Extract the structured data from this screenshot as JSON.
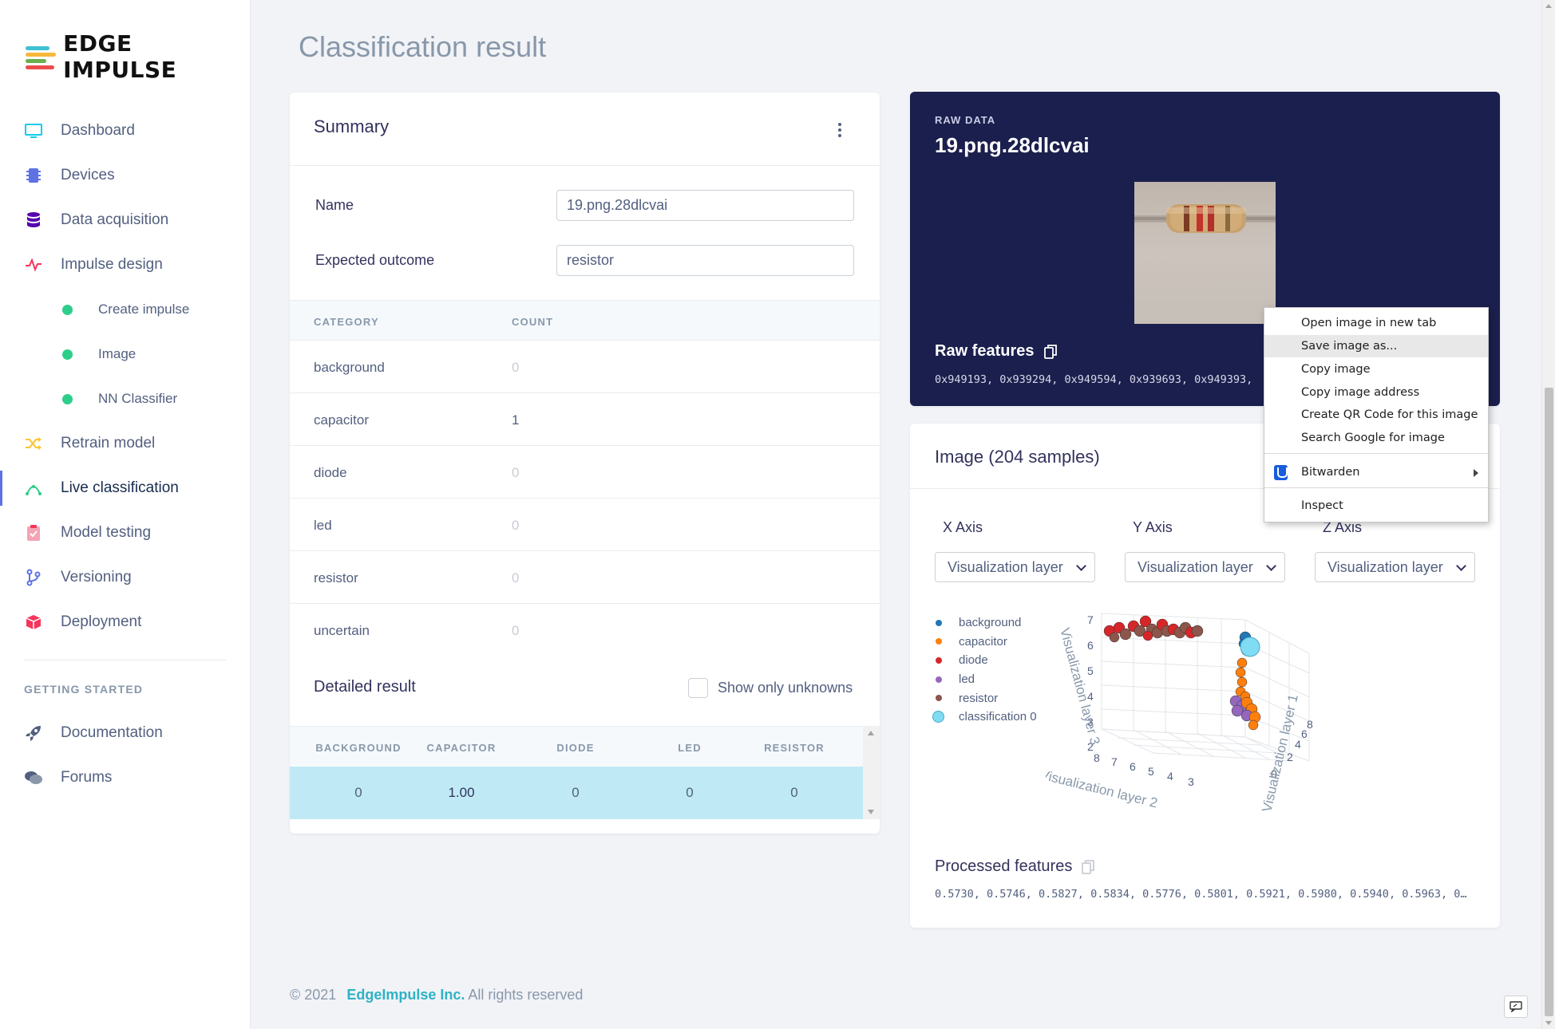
{
  "brand": {
    "name": "EDGE IMPULSE"
  },
  "nav": {
    "items": [
      {
        "label": "Dashboard",
        "icon": "monitor-icon"
      },
      {
        "label": "Devices",
        "icon": "chip-icon"
      },
      {
        "label": "Data acquisition",
        "icon": "database-icon"
      },
      {
        "label": "Impulse design",
        "icon": "pulse-icon"
      },
      {
        "label": "Create impulse",
        "icon": "dot-icon"
      },
      {
        "label": "Image",
        "icon": "dot-icon"
      },
      {
        "label": "NN Classifier",
        "icon": "dot-icon"
      },
      {
        "label": "Retrain model",
        "icon": "shuffle-icon"
      },
      {
        "label": "Live classification",
        "icon": "live-icon"
      },
      {
        "label": "Model testing",
        "icon": "clipboard-check-icon"
      },
      {
        "label": "Versioning",
        "icon": "branch-icon"
      },
      {
        "label": "Deployment",
        "icon": "box-icon"
      }
    ],
    "active": "Live classification",
    "getting_started_heading": "GETTING STARTED",
    "getting_started": [
      {
        "label": "Documentation",
        "icon": "rocket-icon"
      },
      {
        "label": "Forums",
        "icon": "chat-icon"
      }
    ]
  },
  "page": {
    "title": "Classification result"
  },
  "summary": {
    "title": "Summary",
    "name_label": "Name",
    "name_value": "19.png.28dlcvai",
    "expected_label": "Expected outcome",
    "expected_value": "resistor",
    "col_category": "CATEGORY",
    "col_count": "COUNT",
    "rows": [
      {
        "category": "background",
        "count": "0"
      },
      {
        "category": "capacitor",
        "count": "1"
      },
      {
        "category": "diode",
        "count": "0"
      },
      {
        "category": "led",
        "count": "0"
      },
      {
        "category": "resistor",
        "count": "0"
      },
      {
        "category": "uncertain",
        "count": "0"
      }
    ],
    "detailed_title": "Detailed result",
    "show_unknowns_label": "Show only unknowns",
    "detailed_headers": [
      "BACKGROUND",
      "CAPACITOR",
      "DIODE",
      "LED",
      "RESISTOR"
    ],
    "detailed_row": [
      "0",
      "1.00",
      "0",
      "0",
      "0"
    ]
  },
  "raw": {
    "label": "RAW DATA",
    "name": "19.png.28dlcvai",
    "features_title": "Raw features",
    "features_values": "0x949193, 0x939294, 0x949594, 0x939693, 0x949393,"
  },
  "samples": {
    "title": "Image (204 samples)",
    "x_axis_label": "X Axis",
    "y_axis_label": "Y Axis",
    "z_axis_label": "Z Axis",
    "x_select": "Visualization layer",
    "y_select": "Visualization layer",
    "z_select": "Visualization layer",
    "legend": [
      {
        "name": "background",
        "color": "#1f77b4"
      },
      {
        "name": "capacitor",
        "color": "#ff7f0e"
      },
      {
        "name": "diode",
        "color": "#d62728"
      },
      {
        "name": "led",
        "color": "#9467bd"
      },
      {
        "name": "resistor",
        "color": "#8c564b"
      },
      {
        "name": "classification 0",
        "color": "#7fdcf3"
      }
    ],
    "plot_axes": {
      "z_title": "Visualization layer 3",
      "x_title": "Visualization layer 2",
      "y_title": "Visualization layer 1",
      "z_ticks": [
        "7",
        "6",
        "5",
        "4",
        "3",
        "2"
      ],
      "x_ticks": [
        "8",
        "7",
        "6",
        "5",
        "4",
        "3"
      ],
      "y_ticks": [
        "0",
        "2",
        "4",
        "6",
        "8"
      ]
    },
    "processed_title": "Processed features",
    "processed_values": "0.5730, 0.5746, 0.5827, 0.5834, 0.5776, 0.5801, 0.5921, 0.5980, 0.5940, 0.5963, 0…"
  },
  "context_menu": {
    "items": [
      "Open image in new tab",
      "Save image as...",
      "Copy image",
      "Copy image address",
      "Create QR Code for this image",
      "Search Google for image",
      "Bitwarden",
      "Inspect"
    ],
    "highlighted": "Save image as..."
  },
  "footer": {
    "copyright": "© 2021",
    "company": "EdgeImpulse Inc.",
    "rights": "All rights reserved"
  }
}
